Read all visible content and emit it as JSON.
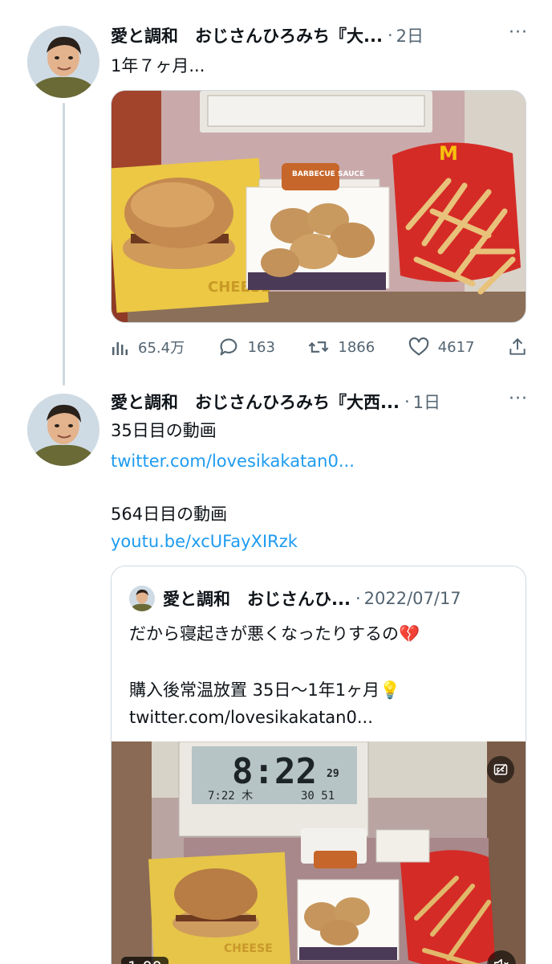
{
  "tweet1": {
    "author": "愛と調和　おじさんひろみち『大...",
    "separator": "·",
    "time": "2日",
    "more": "···",
    "text": "1年７ヶ月...",
    "stats": {
      "views": "65.4万",
      "replies": "163",
      "retweets": "1866",
      "likes": "4617"
    },
    "image_brand": "BARBECUE SAUCE"
  },
  "tweet2": {
    "author": "愛と調和　おじさんひろみち『大西...",
    "separator": "·",
    "time": "1日",
    "more": "···",
    "line1": "35日目の動画",
    "link1": "twitter.com/lovesikakatan0...",
    "line2": "564日目の動画",
    "link2": "youtu.be/xcUFayXIRzk"
  },
  "quote": {
    "author": "愛と調和　おじさんひ...",
    "separator": "·",
    "time": "2022/07/17",
    "line1": "だから寝起きが悪くなったりするの💔",
    "line2": "購入後常温放置 35日〜1年1ヶ月💡",
    "link": "twitter.com/lovesikakatan0...",
    "video_duration": "1:00",
    "clock_time": "8:22",
    "clock_small": "7:22 木",
    "clock_temp": "29",
    "clock_humidity": "30 51"
  },
  "colors": {
    "link": "#1d9bf0",
    "muted": "#536471",
    "border": "#cfd9de"
  },
  "icons": [
    "views-icon",
    "reply-icon",
    "retweet-icon",
    "like-icon",
    "share-icon",
    "mute-icon",
    "captions-icon"
  ]
}
